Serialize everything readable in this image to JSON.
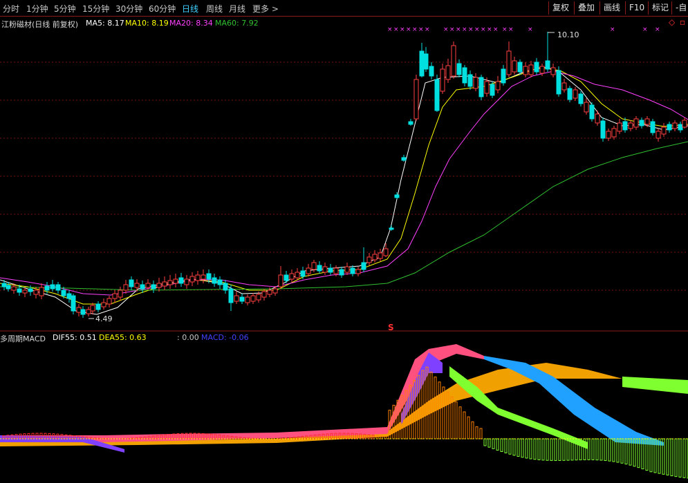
{
  "toolbar": {
    "periods": [
      "分时",
      "1分钟",
      "5分钟",
      "15分钟",
      "30分钟",
      "60分钟",
      "日线",
      "周线",
      "月线",
      "更多 >"
    ],
    "active_index": 6,
    "right_buttons": [
      "复权",
      "叠加",
      "画线",
      "F10",
      "标记",
      "-自"
    ]
  },
  "main_chart": {
    "stock_title": "江粉磁材(日线 前复权)",
    "ma5_label": "MA5: 8.17",
    "ma10_label": "MA10: 8.19",
    "ma20_label": "MA20: 8.34",
    "ma60_label": "MA60: 7.92",
    "high_marker": "10.10",
    "low_marker": "4.49",
    "signal_marker": "S",
    "colors": {
      "up": "#ff4040",
      "down": "#00e0e0",
      "ma5": "#ffffff",
      "ma10": "#ffff00",
      "ma20": "#ff40ff",
      "ma60": "#30c030",
      "grid": "#7a1010"
    }
  },
  "macd_panel": {
    "title": "多周期MACD",
    "dif_label": "DIF55: 0.51",
    "dea_label": "DEA55: 0.63",
    "zero_label": ": 0.00",
    "macd_label": "MACD: -0.06",
    "colors": {
      "dif": "#ffffff",
      "dea": "#ffff00",
      "macd": "#4040ff"
    }
  }
}
